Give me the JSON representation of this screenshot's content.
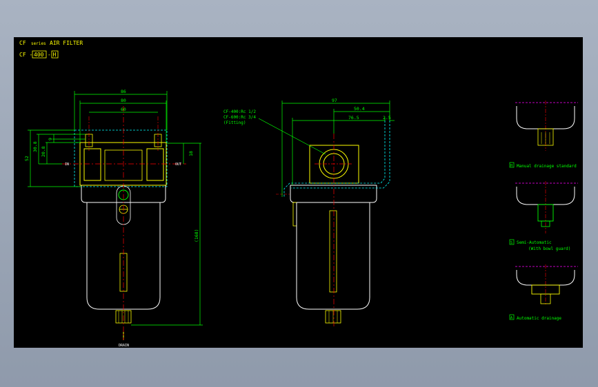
{
  "header": {
    "title_prefix": "CF",
    "title_series": "series",
    "title_name": "AIR FILTER",
    "model_prefix": "CF -",
    "model_size": "400",
    "model_sep": "-",
    "model_option": "H"
  },
  "dims": {
    "d86": "86",
    "d80": "80",
    "d60": "60",
    "d30_8": "30.8",
    "d20_8": "20.8",
    "d52": "52",
    "d9": "9",
    "d18": "18",
    "d168": "(168)",
    "d97": "97",
    "d50_4": "50.4",
    "d76_5": "76.5",
    "d2_5": "2.5"
  },
  "labels": {
    "in": "IN",
    "out": "OUT",
    "drain": "DRAIN",
    "fitting_line1": "CF-400:Rc 1/2",
    "fitting_line2": "CF-600:Rc 3/4",
    "fitting_line3": "(Fitting)"
  },
  "options": [
    {
      "code": "H",
      "text": "Manual drainage standard"
    },
    {
      "code": "S",
      "text": "Semi-Automatic",
      "text2": "(With bowl guard)"
    },
    {
      "code": "A",
      "text": "Automatic drainage"
    }
  ],
  "colors": {
    "background": "#000000",
    "body": "#ffffff",
    "dimension": "#00ff00",
    "center": "#ff0000",
    "highlight": "#ffff00",
    "hidden": "#00ffff",
    "magenta": "#ff00ff"
  }
}
